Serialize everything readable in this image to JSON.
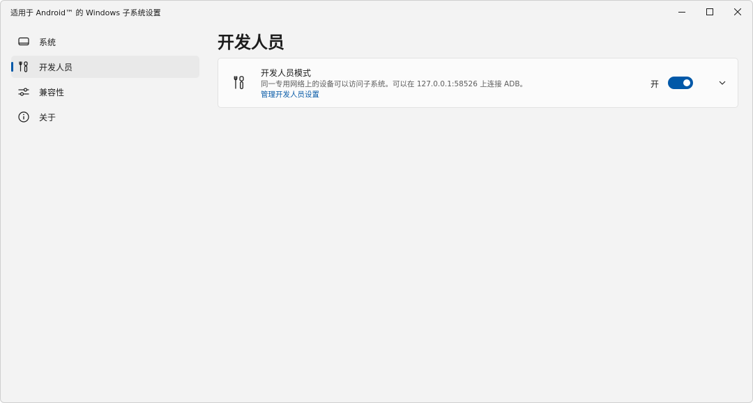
{
  "window": {
    "title": "适用于 Android™ 的 Windows 子系统设置",
    "controls": [
      "minimize-icon",
      "maximize-icon",
      "close-icon"
    ]
  },
  "sidebar": {
    "items": [
      {
        "label": "系统",
        "icon": "monitor-icon",
        "selected": false
      },
      {
        "label": "开发人员",
        "icon": "developer-tools-icon",
        "selected": true
      },
      {
        "label": "兼容性",
        "icon": "sliders-icon",
        "selected": false
      },
      {
        "label": "关于",
        "icon": "info-icon",
        "selected": false
      }
    ]
  },
  "main": {
    "title": "开发人员",
    "developer_mode": {
      "title": "开发人员模式",
      "description": "同一专用网络上的设备可以访问子系统。可以在 127.0.0.1:58526 上连接 ADB。",
      "link": "管理开发人员设置",
      "toggle_label": "开",
      "toggle_on": true,
      "icon": "developer-tools-icon"
    }
  },
  "colors": {
    "accent": "#0058a8",
    "link": "#0a5ca8",
    "background": "#f3f3f3",
    "card": "#fbfbfb"
  }
}
